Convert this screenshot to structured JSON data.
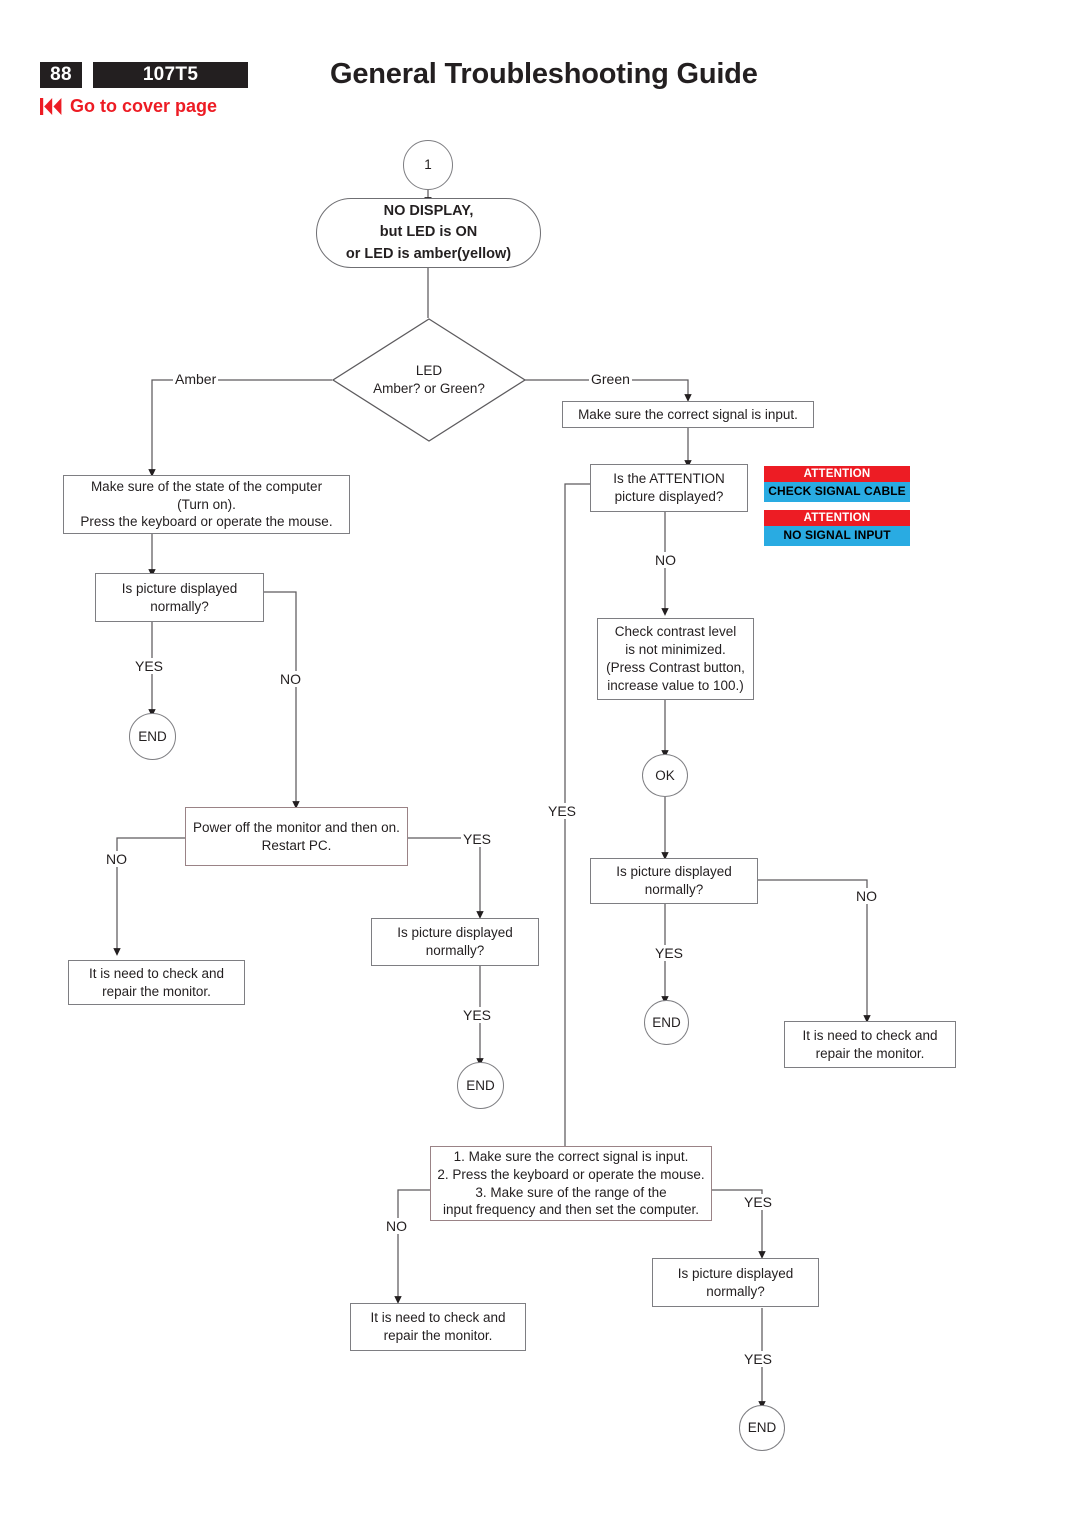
{
  "header": {
    "page_number": "88",
    "model": "107T5",
    "cover_link": "Go to cover page",
    "cover_link_icon": "rewind-to-start-icon",
    "title": "General Troubleshooting Guide",
    "accent_color": "#ed1c24",
    "badge_bg": "#231f20"
  },
  "nodes": {
    "start_marker": "1",
    "symptom": "NO DISPLAY,\nbut LED is ON\nor LED is amber(yellow)",
    "symptom_line1": "NO DISPLAY,",
    "symptom_line2": "but LED is ON",
    "symptom_line3": "or LED is amber(yellow)",
    "led_decision_line1": "LED",
    "led_decision_line2": "Amber? or Green?",
    "check_computer_state_line1": "Make sure of the state of the computer",
    "check_computer_state_line2": "(Turn on).",
    "check_computer_state_line3": "Press the keyboard or operate the mouse.",
    "picture_normal_q_line1": "Is picture displayed",
    "picture_normal_q_line2": "normally?",
    "end_label": "END",
    "power_cycle_line1": "Power off the monitor and then on.",
    "power_cycle_line2": "Restart PC.",
    "repair_line1": "It is need to check and",
    "repair_line2": "repair the monitor.",
    "correct_signal": "Make sure the correct signal is input.",
    "attention_q_line1": "Is the ATTENTION",
    "attention_q_line2": "picture displayed?",
    "contrast_line1": "Check contrast level",
    "contrast_line2": "is not minimized.",
    "contrast_line3": "(Press Contrast button,",
    "contrast_line4": "increase value to 100.)",
    "ok_label": "OK",
    "steps_line1": "1. Make sure the correct signal is input.",
    "steps_line2": "2. Press the keyboard or operate the mouse.",
    "steps_line3": "3. Make sure of the range of the",
    "steps_line4": "input frequency and then set the computer."
  },
  "edges": {
    "amber": "Amber",
    "green": "Green",
    "yes": "YES",
    "no": "NO"
  },
  "attention_badges": [
    {
      "heading": "ATTENTION",
      "message": "CHECK SIGNAL CABLE",
      "heading_color": "#ed1c24",
      "body_color": "#29abe2"
    },
    {
      "heading": "ATTENTION",
      "message": "NO SIGNAL INPUT",
      "heading_color": "#ed1c24",
      "body_color": "#29abe2"
    }
  ]
}
